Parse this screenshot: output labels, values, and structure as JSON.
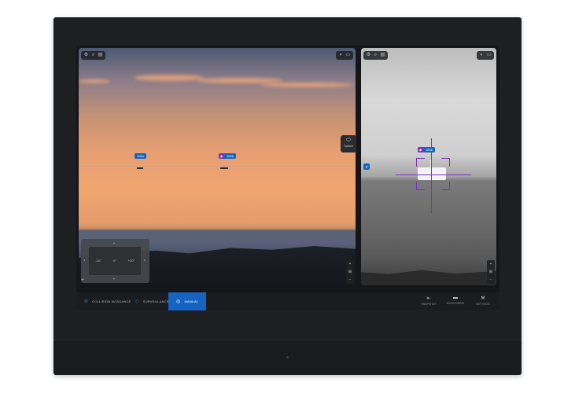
{
  "left_view": {
    "tags": [
      {
        "id": "1004",
        "cls": ""
      },
      {
        "id": "1006",
        "cls": "◆"
      }
    ],
    "ptz": {
      "left": "-20°",
      "center": "0°",
      "right": "+20°"
    },
    "handle_label": "Switch"
  },
  "right_view": {
    "tag": {
      "id": "1006",
      "cls": "◆"
    }
  },
  "bottom_bar": {
    "modes": [
      {
        "label": "COLLISION AVOIDANCE",
        "icon": "shield-icon"
      },
      {
        "label": "SURVEILLANCE",
        "icon": "eye-icon"
      },
      {
        "label": "MANUAL",
        "icon": "target-icon"
      }
    ],
    "actions": [
      {
        "label": "SNAPSHOT",
        "icon": "camera-icon"
      },
      {
        "label": "MONITORING",
        "icon": "monitor-icon"
      },
      {
        "label": "SETTINGS",
        "icon": "wrench-icon"
      }
    ]
  }
}
